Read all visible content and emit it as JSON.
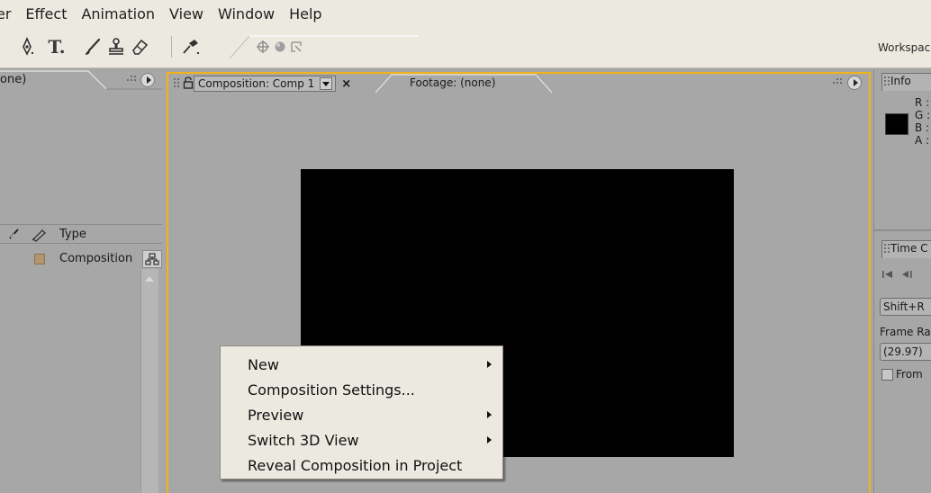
{
  "menubar": {
    "items": [
      "er",
      "Effect",
      "Animation",
      "View",
      "Window",
      "Help"
    ]
  },
  "toolbar": {
    "tools": [
      {
        "icon": "pen-tool-icon"
      },
      {
        "icon": "type-tool-icon",
        "label": "T."
      },
      {
        "icon": "brush-tool-icon"
      },
      {
        "icon": "clone-stamp-icon"
      },
      {
        "icon": "eraser-icon"
      },
      {
        "icon": "puppet-pin-icon"
      }
    ],
    "axis_icons": [
      "axis-local-icon",
      "axis-world-icon",
      "axis-view-icon"
    ],
    "workspace_label": "Workspac"
  },
  "left_panel": {
    "tab_label": "one)",
    "column_header": {
      "type": "Type"
    },
    "rows": [
      {
        "type": "Composition",
        "label_color": "#b4966e"
      }
    ]
  },
  "composition_panel": {
    "active_tab": "Composition: Comp 1",
    "close_glyph": "×",
    "footage_tab": "Footage: (none)",
    "accent_color": "#f2b21a",
    "canvas_color": "#000000"
  },
  "context_menu": {
    "items": [
      {
        "label": "New",
        "submenu": true
      },
      {
        "label": "Composition Settings...",
        "submenu": false
      },
      {
        "label": "Preview",
        "submenu": true
      },
      {
        "label": "Switch 3D View",
        "submenu": true
      },
      {
        "label": "Reveal Composition in Project",
        "submenu": false
      }
    ]
  },
  "info_panel": {
    "tab_label": "Info",
    "channels": [
      "R :",
      "G :",
      "B :",
      "A :"
    ]
  },
  "time_controls": {
    "tab_label": "Time C",
    "shortcut_label": "Shift+R",
    "frame_rate_label": "Frame Ra",
    "frame_rate_value": "(29.97)",
    "from_checkbox_label": "From"
  }
}
